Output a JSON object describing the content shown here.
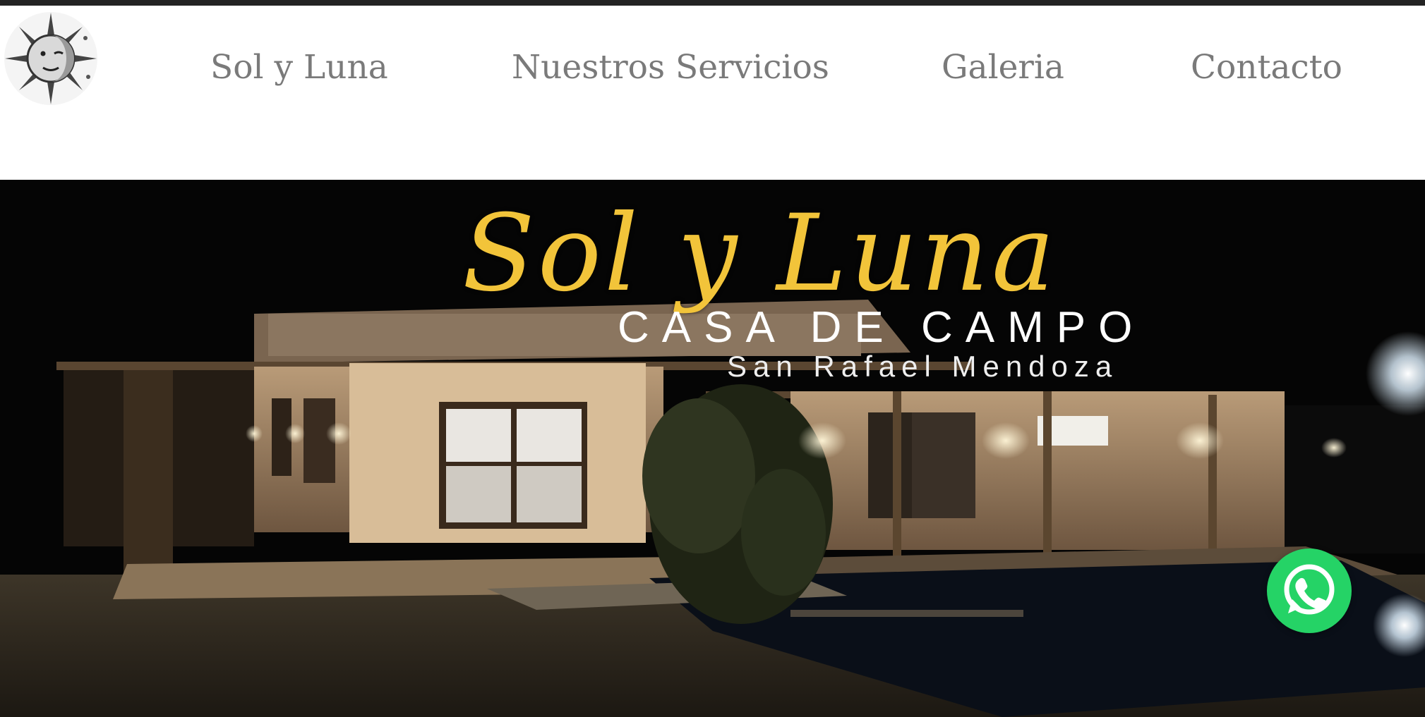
{
  "nav": {
    "items": [
      {
        "label": "Sol y Luna"
      },
      {
        "label": "Nuestros Servicios"
      },
      {
        "label": "Galeria"
      },
      {
        "label": "Contacto"
      }
    ],
    "text_color": "#7a7a7a"
  },
  "logo": {
    "icon": "sun-moon-logo-icon"
  },
  "hero": {
    "title": "Sol y Luna",
    "subtitle": "CASA DE CAMPO",
    "location": "San Rafael Mendoza",
    "title_color": "#f2c43a"
  },
  "whatsapp": {
    "icon": "whatsapp-icon",
    "color": "#25d366"
  }
}
